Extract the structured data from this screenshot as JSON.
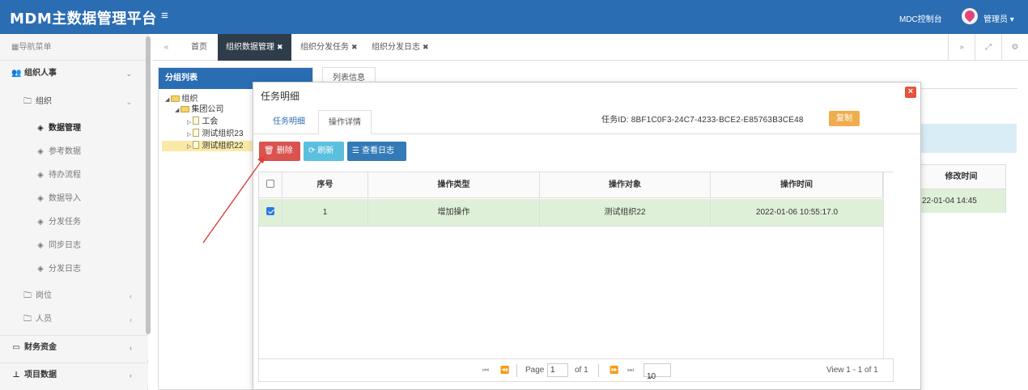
{
  "app": {
    "title": "MDM主数据管理平台",
    "console_label": "MDC控制台",
    "user_label": "管理员"
  },
  "sidebar": {
    "nav_header": "导航菜单",
    "items": [
      {
        "label": "组织人事"
      },
      {
        "label": "组织"
      },
      {
        "label": "数据管理"
      },
      {
        "label": "参考数据"
      },
      {
        "label": "待办流程"
      },
      {
        "label": "数据导入"
      },
      {
        "label": "分发任务"
      },
      {
        "label": "同步日志"
      },
      {
        "label": "分发日志"
      },
      {
        "label": "岗位"
      },
      {
        "label": "人员"
      },
      {
        "label": "财务资金"
      },
      {
        "label": "项目数据"
      }
    ]
  },
  "tabs": [
    {
      "label": "首页"
    },
    {
      "label": "组织数据管理"
    },
    {
      "label": "组织分发任务"
    },
    {
      "label": "组织分发日志"
    }
  ],
  "tree": {
    "title": "分组列表",
    "nodes": [
      {
        "label": "组织"
      },
      {
        "label": "集团公司"
      },
      {
        "label": "工会"
      },
      {
        "label": "测试组织23"
      },
      {
        "label": "测试组织22"
      }
    ]
  },
  "background": {
    "tab_label": "列表信息",
    "col_header": "修改时间",
    "cell_value": "22-01-04 14:45"
  },
  "modal": {
    "title": "任务明细",
    "tabs": [
      {
        "label": "任务明细"
      },
      {
        "label": "操作详情"
      }
    ],
    "task_id_label": "任务ID:",
    "task_id_value": "8BF1C0F3-24C7-4233-BCE2-E85763B3CE48",
    "copy_label": "复制",
    "toolbar": {
      "delete_label": "删除",
      "refresh_label": "刷新",
      "log_label": "查看日志"
    },
    "table": {
      "headers": [
        "序号",
        "操作类型",
        "操作对象",
        "操作时间"
      ],
      "rows": [
        {
          "seq": "1",
          "type": "增加操作",
          "target": "测试组织22",
          "time": "2022-01-06 10:55:17.0",
          "checked": true
        }
      ]
    },
    "pager": {
      "page_label": "Page",
      "page_value": "1",
      "of_label": "of 1",
      "page_size": "10",
      "view_label": "View 1 - 1 of 1"
    }
  },
  "colors": {
    "header": "#2b6db3",
    "delete": "#d9534f",
    "refresh": "#5bc0de",
    "log": "#337ab7",
    "copy": "#f0ad4e",
    "row_selected": "#dff0d8"
  }
}
